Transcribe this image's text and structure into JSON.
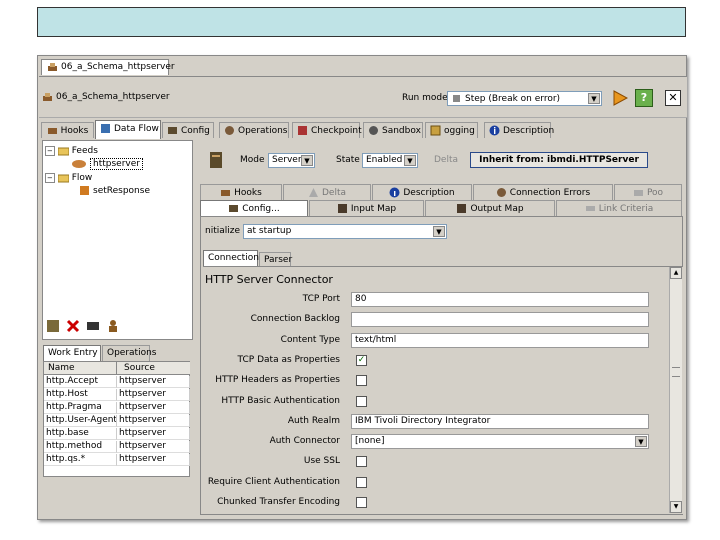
{
  "outer_tab": {
    "label": "06_a_Schema_httpserver"
  },
  "header": {
    "assembly_line": "06_a_Schema_httpserver",
    "run_mode_label": "Run mode",
    "run_mode_value": "Step (Break on error)"
  },
  "main_tabs": [
    {
      "label": "Hooks",
      "icon": "hook-icon"
    },
    {
      "label": "Data Flow",
      "icon": "dataflow-icon"
    },
    {
      "label": "Config",
      "icon": "config-icon"
    },
    {
      "label": "Operations",
      "icon": "operations-icon"
    },
    {
      "label": "Checkpoint",
      "icon": "checkpoint-icon"
    },
    {
      "label": "Sandbox",
      "icon": "sandbox-icon"
    },
    {
      "label": "ogging",
      "icon": "book-icon"
    },
    {
      "label": "Description",
      "icon": "info-icon"
    }
  ],
  "tree": {
    "feeds": "Feeds",
    "feeds_child": "httpserver",
    "flow": "Flow",
    "flow_child": "setResponse"
  },
  "work_tabs": {
    "work_entry": "Work Entry",
    "operations": "Operations"
  },
  "work_table": {
    "headers": [
      "Name",
      "Source"
    ],
    "rows": [
      [
        "http.Accept",
        "httpserver"
      ],
      [
        "http.Host",
        "httpserver"
      ],
      [
        "http.Pragma",
        "httpserver"
      ],
      [
        "http.User-Agent",
        "httpserver"
      ],
      [
        "http.base",
        "httpserver"
      ],
      [
        "http.method",
        "httpserver"
      ],
      [
        "http.qs.*",
        "httpserver"
      ]
    ]
  },
  "component": {
    "mode_label": "Mode",
    "mode_value": "Server",
    "state_label": "State",
    "state_value": "Enabled",
    "delta_label": "Delta",
    "inherit_button": "Inherit from: ibmdi.HTTPServer"
  },
  "comp_tabs_row1": [
    "Hooks",
    "Delta",
    "Description",
    "Connection Errors",
    "Poo"
  ],
  "comp_tabs_row2": [
    "Config...",
    "Input Map",
    "Output Map",
    "Link Criteria"
  ],
  "initialize": {
    "label": "nitialize",
    "value": "at startup"
  },
  "sub_tabs": [
    "Connection",
    "Parser"
  ],
  "connector": {
    "section_title": "HTTP Server Connector",
    "fields": [
      {
        "label": "TCP Port",
        "value": "80"
      },
      {
        "label": "Connection Backlog",
        "value": ""
      },
      {
        "label": "Content Type",
        "value": "text/html"
      },
      {
        "label": "TCP Data as Properties",
        "checked": true
      },
      {
        "label": "HTTP Headers as Properties",
        "checked": false
      },
      {
        "label": "HTTP Basic Authentication",
        "checked": false
      },
      {
        "label": "Auth Realm",
        "value": "IBM Tivoli Directory Integrator"
      },
      {
        "label": "Auth Connector",
        "value": "[none]"
      },
      {
        "label": "Use SSL",
        "checked": false
      },
      {
        "label": "Require Client Authentication",
        "checked": false
      },
      {
        "label": "Chunked Transfer Encoding",
        "checked": false
      }
    ]
  },
  "colors": {
    "banner": "#bfe3e6",
    "window": "#d4d0c8",
    "selection": "#0a246a"
  }
}
